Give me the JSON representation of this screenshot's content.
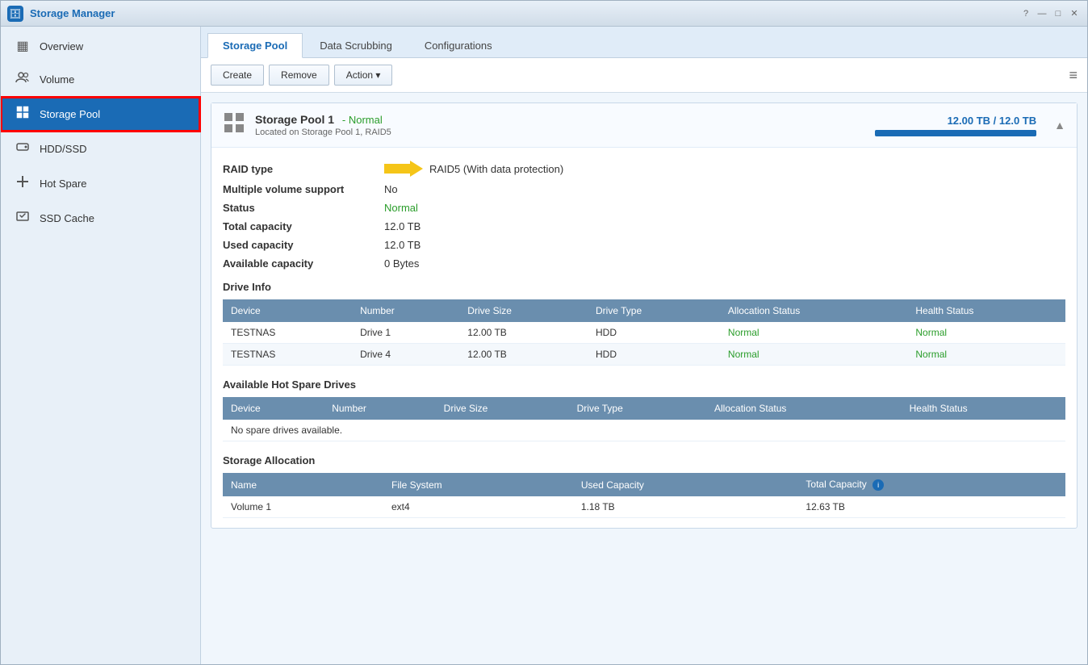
{
  "window": {
    "title": "Storage Manager",
    "app_icon": "🗄"
  },
  "title_controls": [
    "?",
    "—",
    "□",
    "✕"
  ],
  "sidebar": {
    "items": [
      {
        "id": "overview",
        "label": "Overview",
        "icon": "▦",
        "active": false
      },
      {
        "id": "volume",
        "label": "Volume",
        "icon": "👥",
        "active": false
      },
      {
        "id": "storage-pool",
        "label": "Storage Pool",
        "icon": "▦",
        "active": true
      },
      {
        "id": "hdd-ssd",
        "label": "HDD/SSD",
        "icon": "⊙",
        "active": false
      },
      {
        "id": "hot-spare",
        "label": "Hot Spare",
        "icon": "✚",
        "active": false
      },
      {
        "id": "ssd-cache",
        "label": "SSD Cache",
        "icon": "⚡",
        "active": false
      }
    ]
  },
  "tabs": [
    {
      "id": "storage-pool",
      "label": "Storage Pool",
      "active": true
    },
    {
      "id": "data-scrubbing",
      "label": "Data Scrubbing",
      "active": false
    },
    {
      "id": "configurations",
      "label": "Configurations",
      "active": false
    }
  ],
  "toolbar": {
    "create_label": "Create",
    "remove_label": "Remove",
    "action_label": "Action ▾"
  },
  "pool": {
    "name": "Storage Pool 1",
    "status_label": "- Normal",
    "location": "Located on Storage Pool 1, RAID5",
    "capacity_text": "12.00 TB / 12.0  TB",
    "capacity_percent": 100,
    "details": {
      "raid_type_label": "RAID type",
      "raid_type_value": "RAID5  (With data protection)",
      "multiple_volume_label": "Multiple volume support",
      "multiple_volume_value": "No",
      "status_label": "Status",
      "status_value": "Normal",
      "total_capacity_label": "Total capacity",
      "total_capacity_value": "12.0  TB",
      "used_capacity_label": "Used capacity",
      "used_capacity_value": "12.0  TB",
      "available_capacity_label": "Available capacity",
      "available_capacity_value": "0 Bytes"
    },
    "drive_info": {
      "section_title": "Drive Info",
      "columns": [
        "Device",
        "Number",
        "Drive Size",
        "Drive Type",
        "Allocation Status",
        "Health Status"
      ],
      "rows": [
        {
          "device": "TESTNAS",
          "number": "Drive 1",
          "size": "12.00 TB",
          "type": "HDD",
          "alloc_status": "Normal",
          "health_status": "Normal"
        },
        {
          "device": "TESTNAS",
          "number": "Drive 4",
          "size": "12.00 TB",
          "type": "HDD",
          "alloc_status": "Normal",
          "health_status": "Normal"
        }
      ]
    },
    "hot_spare": {
      "section_title": "Available Hot Spare Drives",
      "columns": [
        "Device",
        "Number",
        "Drive Size",
        "Drive Type",
        "Allocation Status",
        "Health Status"
      ],
      "no_data_message": "No spare drives available."
    },
    "storage_allocation": {
      "section_title": "Storage Allocation",
      "columns": [
        "Name",
        "File System",
        "Used Capacity",
        "Total Capacity"
      ],
      "rows": [
        {
          "name": "Volume 1",
          "filesystem": "ext4",
          "used_capacity": "1.18 TB",
          "total_capacity": "12.63 TB"
        }
      ]
    }
  }
}
